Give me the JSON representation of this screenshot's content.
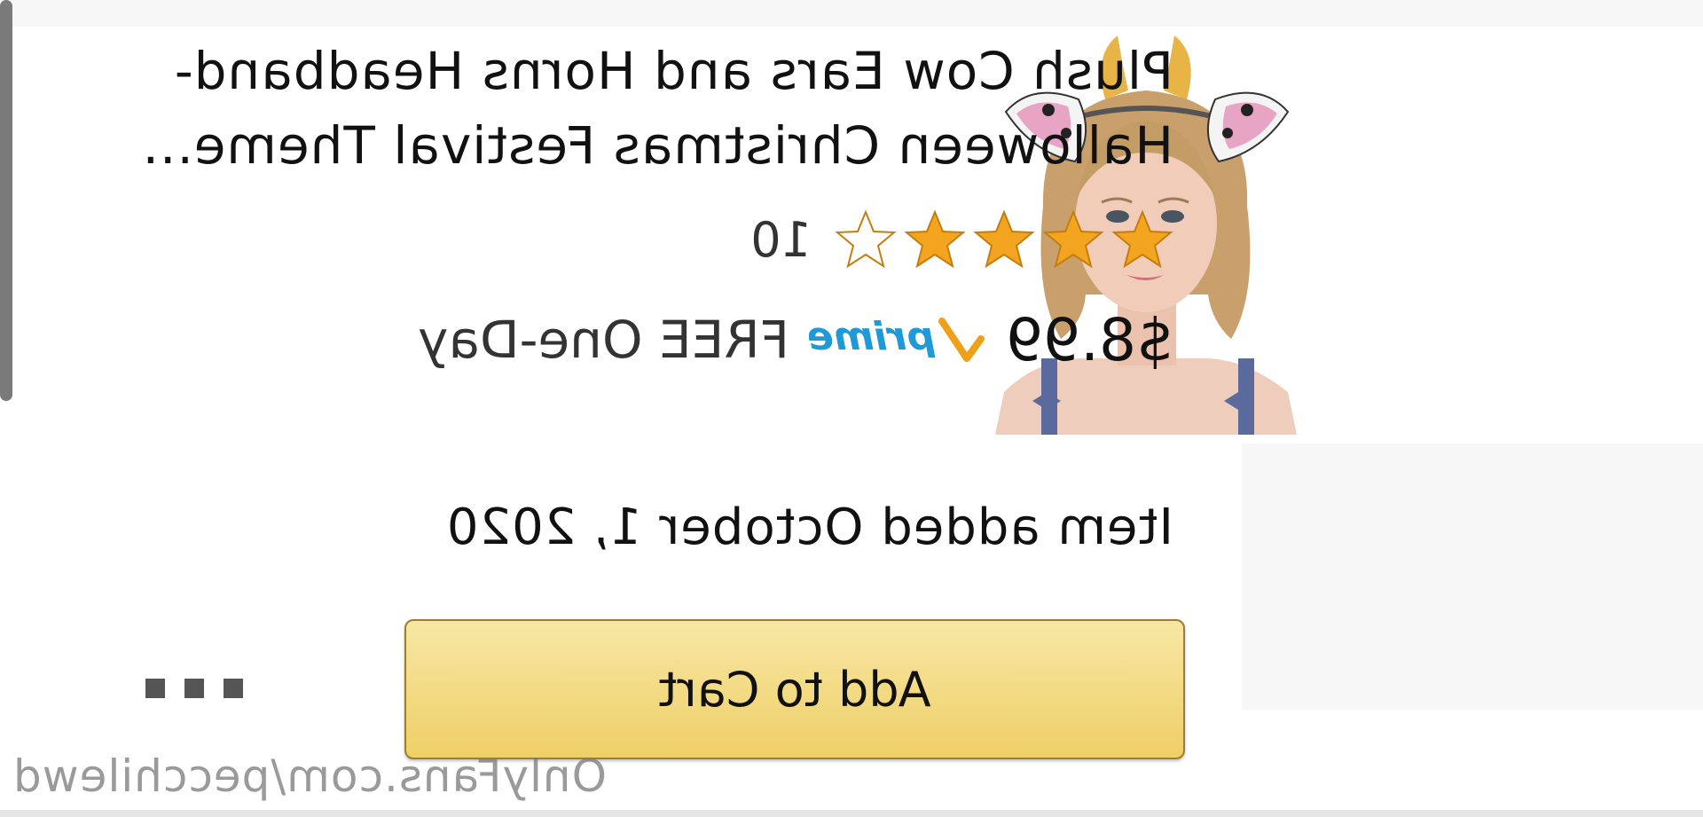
{
  "product": {
    "title": "Plush Cow Ears and Horns Headband-Halloween Christmas Festival Theme...",
    "rating": {
      "stars": 4,
      "max_stars": 5,
      "count": "10",
      "star_icon": "star-icon"
    },
    "price": "$8.99",
    "prime_badge": "prime",
    "delivery": "FREE One-Day",
    "image_alt": "product-photo"
  },
  "list_item": {
    "added_date": "Item added October 1, 2020"
  },
  "actions": {
    "add_to_cart_label": "Add to Cart",
    "more_icon": "more-options-icon"
  },
  "overlay": {
    "watermark": "OnlyFans.com/pecchilewd"
  },
  "colors": {
    "button_top": "#f7e7a4",
    "button_bottom": "#efcf67",
    "button_border": "#9c7e31",
    "star_fill": "#f3a51f",
    "prime_blue": "#1f9ad6",
    "prime_check": "#f0a018",
    "text": "#111111"
  }
}
